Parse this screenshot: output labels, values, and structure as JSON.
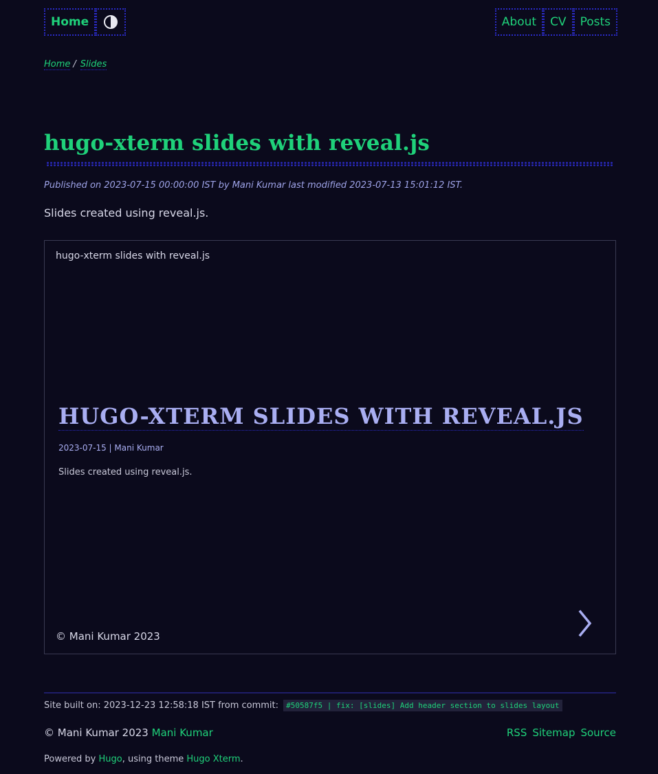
{
  "nav": {
    "home_label": "Home",
    "theme_toggle_icon": "contrast-icon",
    "right_links": [
      "About",
      "CV",
      "Posts"
    ]
  },
  "breadcrumb": {
    "home": "Home",
    "separator": "/",
    "current": "Slides"
  },
  "post": {
    "title": "hugo-xterm slides with reveal.js",
    "meta": "Published on 2023-07-15 00:00:00 IST by Mani Kumar last modified 2023-07-13 15:01:12 IST.",
    "description": "Slides created using reveal.js."
  },
  "slides": {
    "header": "hugo-xterm slides with reveal.js",
    "title": "HUGO-XTERM SLIDES WITH REVEAL.JS",
    "meta": "2023-07-15 | Mani Kumar",
    "description": "Slides created using reveal.js.",
    "footer": "© Mani Kumar 2023",
    "next_icon": "chevron-right-icon"
  },
  "footer": {
    "build_prefix": "Site built on: 2023-12-23 12:58:18 IST from commit:",
    "commit": "#50587f5 | fix: [slides] Add header section to slides layout",
    "copyright_prefix": "© Mani Kumar 2023",
    "copyright_link": "Mani Kumar",
    "links": [
      "RSS",
      "Sitemap",
      "Source"
    ],
    "powered_prefix": "Powered by",
    "powered_hugo": "Hugo",
    "powered_middle": ", using theme",
    "powered_theme": "Hugo Xterm",
    "powered_suffix": "."
  },
  "colors": {
    "background": "#0b0a1c",
    "accent_green": "#1fd17a",
    "accent_blue": "#2b2bc8",
    "slide_text": "#a9aef2"
  }
}
